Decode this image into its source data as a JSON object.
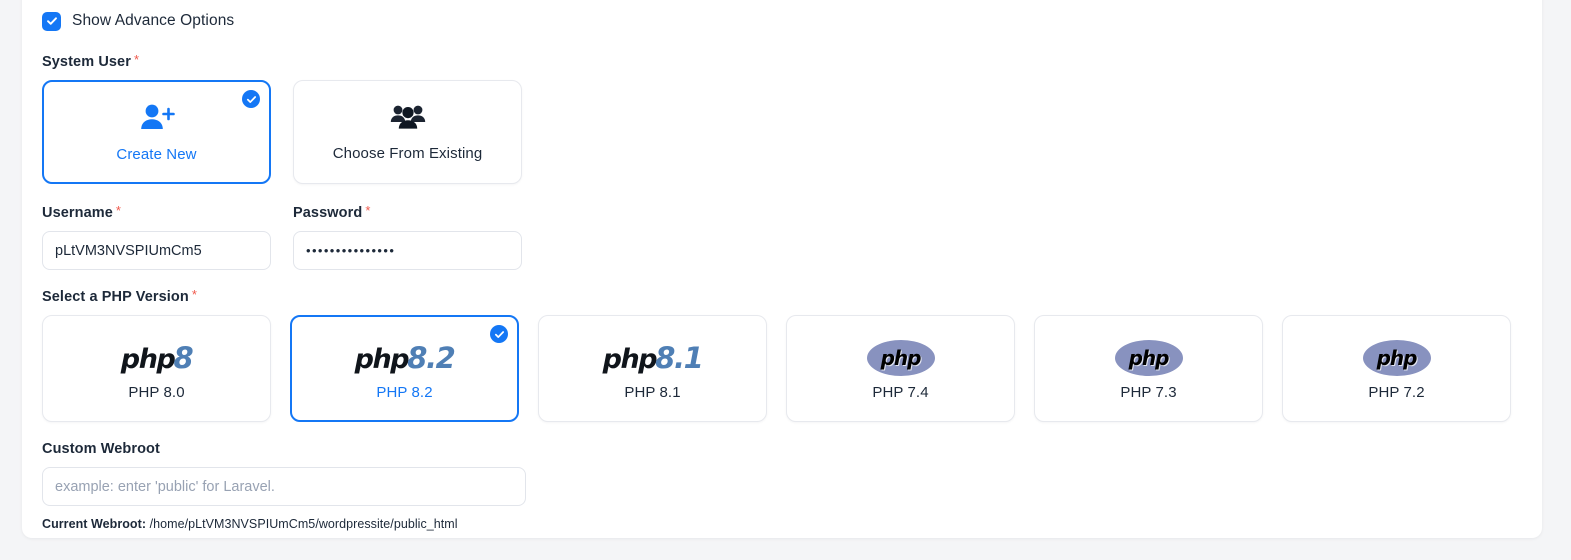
{
  "advanced_toggle": {
    "label": "Show Advance Options",
    "checked": true,
    "icon": "checkbox-checked-icon"
  },
  "system_user": {
    "label": "System User",
    "required_mark": "*",
    "options": [
      {
        "label": "Create New",
        "icon": "user-plus-icon",
        "selected": true
      },
      {
        "label": "Choose From Existing",
        "icon": "users-group-icon",
        "selected": false
      }
    ]
  },
  "username": {
    "label": "Username",
    "required_mark": "*",
    "value": "pLtVM3NVSPIUmCm5",
    "placeholder": ""
  },
  "password": {
    "label": "Password",
    "required_mark": "*",
    "masked_value": "•••••••••••••••"
  },
  "php_version": {
    "label": "Select a PHP Version",
    "required_mark": "*",
    "options": [
      {
        "name": "PHP 8.0",
        "logo": "php8-logo",
        "major": "php",
        "minor": "8",
        "selected": false
      },
      {
        "name": "PHP 8.2",
        "logo": "php8-logo",
        "major": "php",
        "minor": "8.2",
        "selected": true
      },
      {
        "name": "PHP 8.1",
        "logo": "php8-logo",
        "major": "php",
        "minor": "8.1",
        "selected": false
      },
      {
        "name": "PHP 7.4",
        "logo": "php-classic-logo",
        "major": "php",
        "minor": "",
        "selected": false
      },
      {
        "name": "PHP 7.3",
        "logo": "php-classic-logo",
        "major": "php",
        "minor": "",
        "selected": false
      },
      {
        "name": "PHP 7.2",
        "logo": "php-classic-logo",
        "major": "php",
        "minor": "",
        "selected": false
      }
    ]
  },
  "custom_webroot": {
    "label": "Custom Webroot",
    "placeholder": "example: enter 'public' for Laravel.",
    "value": "",
    "current_label": "Current Webroot:",
    "current_path": "/home/pLtVM3NVSPIUmCm5/wordpressite/public_html"
  },
  "colors": {
    "accent": "#1477f5",
    "required": "#f0594c",
    "text": "#1d2939",
    "border": "#e7e9ee",
    "php_classic_purple": "#8892bf",
    "page_bg": "#f4f5f7"
  }
}
